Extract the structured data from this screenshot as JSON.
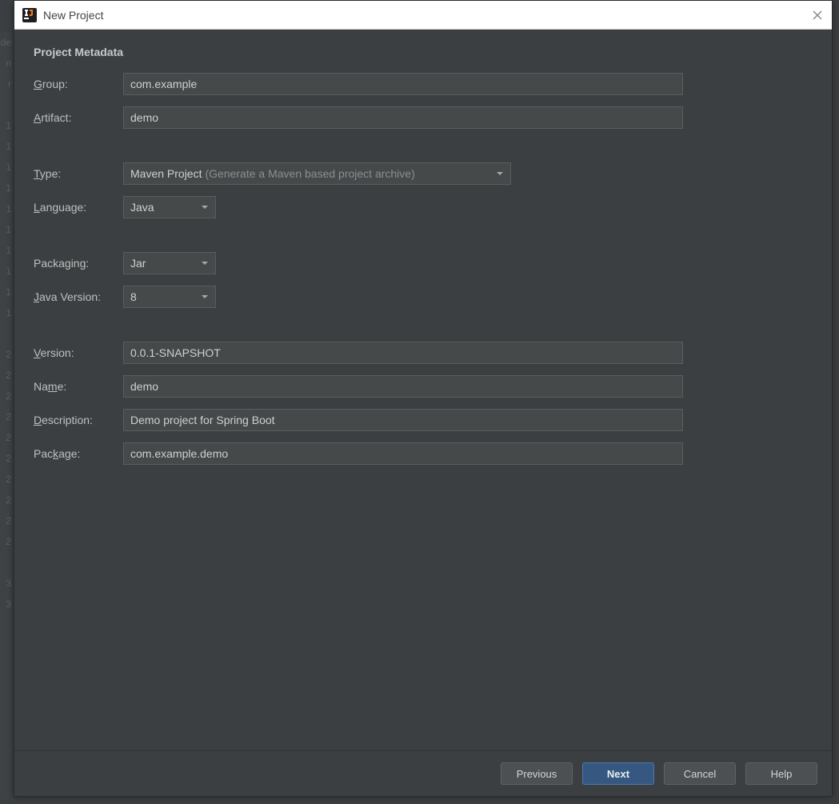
{
  "window": {
    "title": "New Project"
  },
  "section": {
    "title": "Project Metadata"
  },
  "labels": {
    "group": "roup:",
    "artifact": "rtifact:",
    "type": "ype:",
    "language": "anguage:",
    "packaging": "Packaging:",
    "javaVersion": "ava Version:",
    "version": "ersion:",
    "name": "Na",
    "name_suffix": "e:",
    "description": "escription:",
    "package": "Pac",
    "package_suffix": "age:"
  },
  "mnemonics": {
    "group": "G",
    "artifact": "A",
    "type": "T",
    "language": "L",
    "javaVersion": "J",
    "version": "V",
    "name": "m",
    "description": "D",
    "package": "k"
  },
  "values": {
    "group": "com.example",
    "artifact": "demo",
    "type": "Maven Project",
    "type_hint": "(Generate a Maven based project archive)",
    "language": "Java",
    "packaging": "Jar",
    "javaVersion": "8",
    "version": "0.0.1-SNAPSHOT",
    "name": "demo",
    "description": "Demo project for Spring Boot",
    "package": "com.example.demo"
  },
  "buttons": {
    "previous": "Previous",
    "next": "Next",
    "cancel": "Cancel",
    "help": "Help"
  }
}
